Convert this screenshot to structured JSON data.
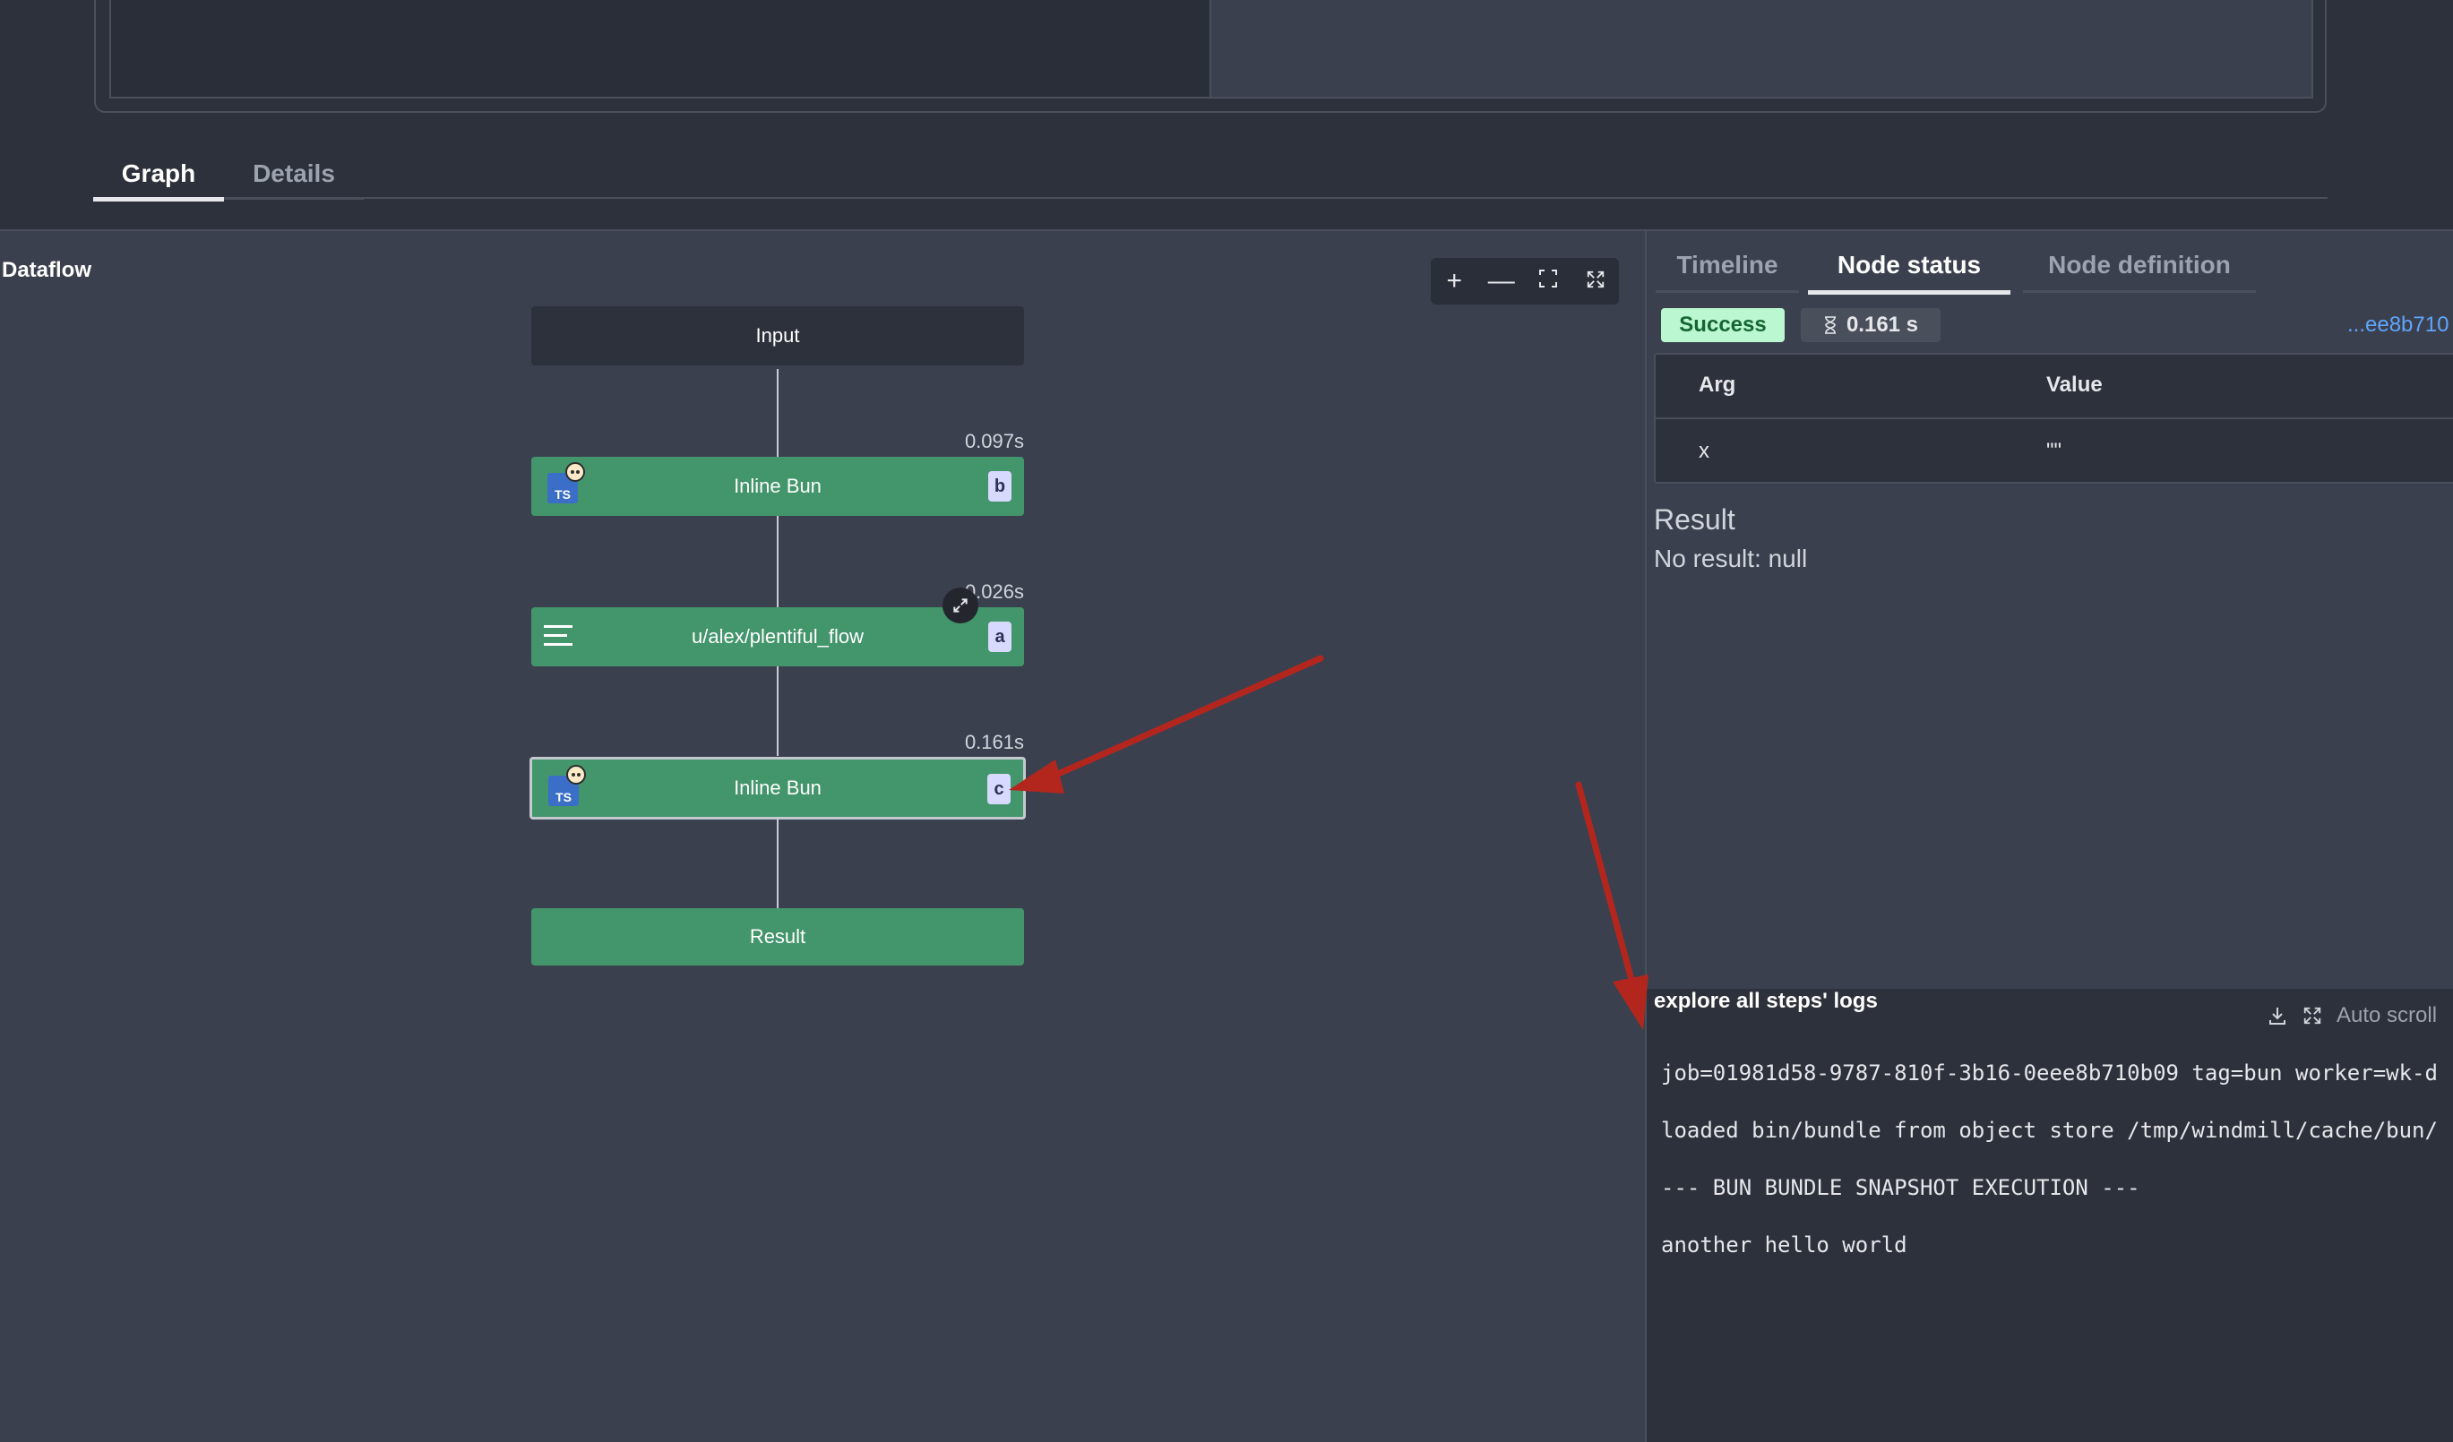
{
  "tabs": {
    "graph": "Graph",
    "details": "Details"
  },
  "graph": {
    "title": "Dataflow",
    "toolbar": {
      "zoom_in": "+",
      "zoom_out": "—",
      "fit": "⛶",
      "fullscreen": "⤢"
    },
    "nodes": {
      "input": {
        "label": "Input"
      },
      "step_b": {
        "label": "Inline Bun",
        "badge": "b",
        "duration": "0.097s",
        "icon": "typescript-bun-icon"
      },
      "step_a": {
        "label": "u/alex/plentiful_flow",
        "badge": "a",
        "duration": "0.026s",
        "icon": "flow-icon"
      },
      "step_c": {
        "label": "Inline Bun",
        "badge": "c",
        "duration": "0.161s",
        "icon": "typescript-bun-icon"
      },
      "result": {
        "label": "Result"
      }
    }
  },
  "panel": {
    "tabs": {
      "timeline": "Timeline",
      "node_status": "Node status",
      "node_definition": "Node definition"
    },
    "status": "Success",
    "duration": "0.161 s",
    "job_link": "...ee8b710",
    "args": {
      "headers": {
        "arg": "Arg",
        "value": "Value"
      },
      "rows": [
        {
          "arg": "x",
          "value": "\"\""
        }
      ]
    },
    "result_title": "Result",
    "result_text": "No result: null",
    "logs": {
      "title": "explore all steps' logs",
      "auto_scroll": "Auto scroll",
      "lines": [
        "job=01981d58-9787-810f-3b16-0eee8b710b09 tag=bun worker=wk-d",
        "loaded bin/bundle from object store /tmp/windmill/cache/bun/",
        "--- BUN BUNDLE SNAPSHOT EXECUTION ---",
        "another hello world"
      ]
    }
  },
  "colors": {
    "node_green": "#43956b",
    "badge": "#d7d9ff",
    "success": "#bbf7d0",
    "annotation_arrow": "#b3261e"
  }
}
